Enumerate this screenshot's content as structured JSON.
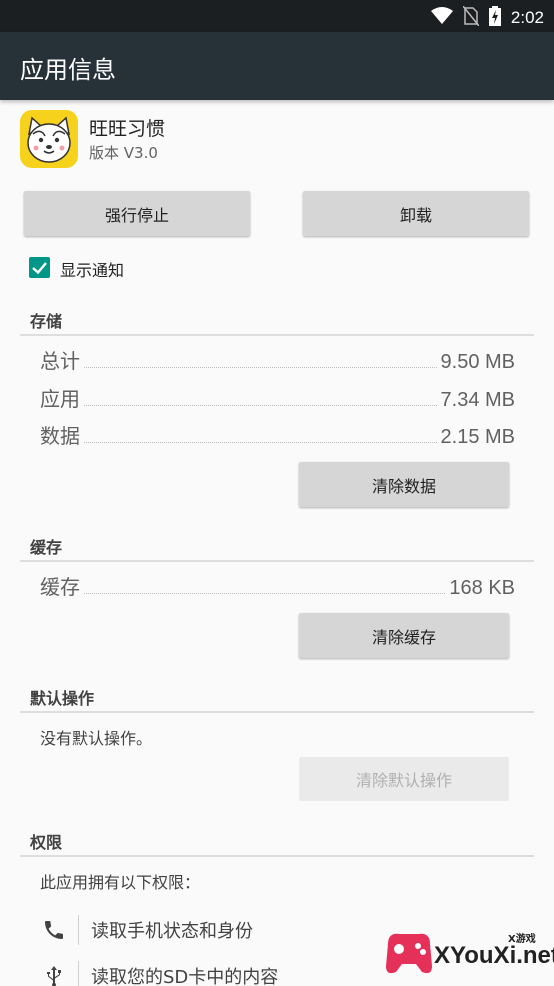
{
  "status_bar": {
    "time": "2:02",
    "icons": [
      "wifi-icon",
      "no-sim-icon",
      "battery-charging-icon"
    ]
  },
  "app_bar": {
    "title": "应用信息"
  },
  "app": {
    "icon": "shiba-dog-icon",
    "name": "旺旺习惯",
    "version": "版本 V3.0"
  },
  "actions": {
    "force_stop": "强行停止",
    "uninstall": "卸载"
  },
  "notification": {
    "label": "显示通知",
    "checked": true
  },
  "storage": {
    "header": "存储",
    "rows": [
      {
        "label": "总计",
        "value": "9.50 MB"
      },
      {
        "label": "应用",
        "value": "7.34 MB"
      },
      {
        "label": "数据",
        "value": "2.15 MB"
      }
    ],
    "clear_button": "清除数据"
  },
  "cache": {
    "header": "缓存",
    "rows": [
      {
        "label": "缓存",
        "value": "168 KB"
      }
    ],
    "clear_button": "清除缓存"
  },
  "defaults": {
    "header": "默认操作",
    "text": "没有默认操作。",
    "clear_button": "清除默认操作"
  },
  "permissions": {
    "header": "权限",
    "intro": "此应用拥有以下权限：",
    "items": [
      {
        "icon": "phone-icon",
        "label": "读取手机状态和身份"
      },
      {
        "icon": "usb-icon",
        "label": "读取您的SD卡中的内容"
      }
    ]
  },
  "watermark": {
    "text": "XYouXi.net",
    "small": "X游戏"
  },
  "colors": {
    "status_bar": "#1c1f22",
    "app_bar": "#263238",
    "accent": "#009688",
    "button": "#d6d6d6"
  }
}
